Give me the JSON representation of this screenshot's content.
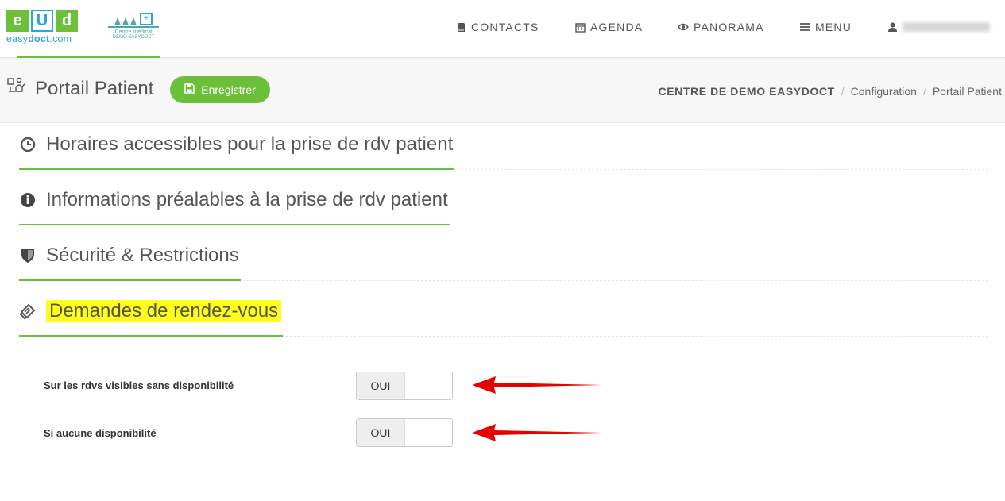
{
  "logo": {
    "letters": [
      "e",
      "U",
      "d"
    ],
    "text_a": "easy",
    "text_b": "doct",
    "text_c": ".com"
  },
  "center_logo": {
    "line1": "Centre médical",
    "line2": "DÉMO EASYDOCT"
  },
  "nav": {
    "contacts": "CONTACTS",
    "agenda": "AGENDA",
    "panorama": "PANORAMA",
    "menu": "MENU"
  },
  "page": {
    "title": "Portail Patient",
    "save_label": "Enregistrer"
  },
  "breadcrumb": {
    "root": "CENTRE DE DEMO EASYDOCT",
    "sep": "/",
    "level1": "Configuration",
    "level2": "Portail Patient"
  },
  "sections": [
    {
      "title": "Horaires accessibles pour la prise de rdv patient",
      "icon": "clock-icon"
    },
    {
      "title": "Informations préalables à la prise de rdv patient",
      "icon": "info-circle-icon"
    },
    {
      "title": "Sécurité & Restrictions",
      "icon": "shield-icon"
    },
    {
      "title": "Demandes de rendez-vous",
      "icon": "ticket-icon"
    }
  ],
  "options": [
    {
      "label": "Sur les rdvs visibles sans disponibilité",
      "value": "OUI"
    },
    {
      "label": "Si aucune disponibilité",
      "value": "OUI"
    }
  ],
  "colors": {
    "accent": "#6cbf3a",
    "highlight": "#ffff1a",
    "arrow": "#e60000"
  }
}
